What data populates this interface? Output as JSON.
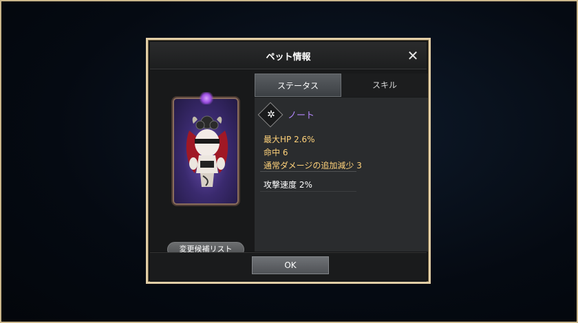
{
  "dialog": {
    "title": "ペット情報"
  },
  "pet": {
    "change_list_label": "変更候補リスト"
  },
  "tabs": [
    {
      "label": "ステータス",
      "active": true
    },
    {
      "label": "スキル",
      "active": false
    }
  ],
  "stats": {
    "pet_name": "ノート",
    "element_icon": "shadow-element-icon",
    "lines": [
      "最大HP 2.6%",
      "命中 6",
      "通常ダメージの追加減少 3"
    ],
    "extra_line": "攻撃速度 2%"
  },
  "footer": {
    "ok_label": "OK"
  },
  "colors": {
    "frame_gold": "#e2cfa7",
    "stat_gold": "#ffd27a",
    "pet_name_purple": "#b688ff"
  }
}
